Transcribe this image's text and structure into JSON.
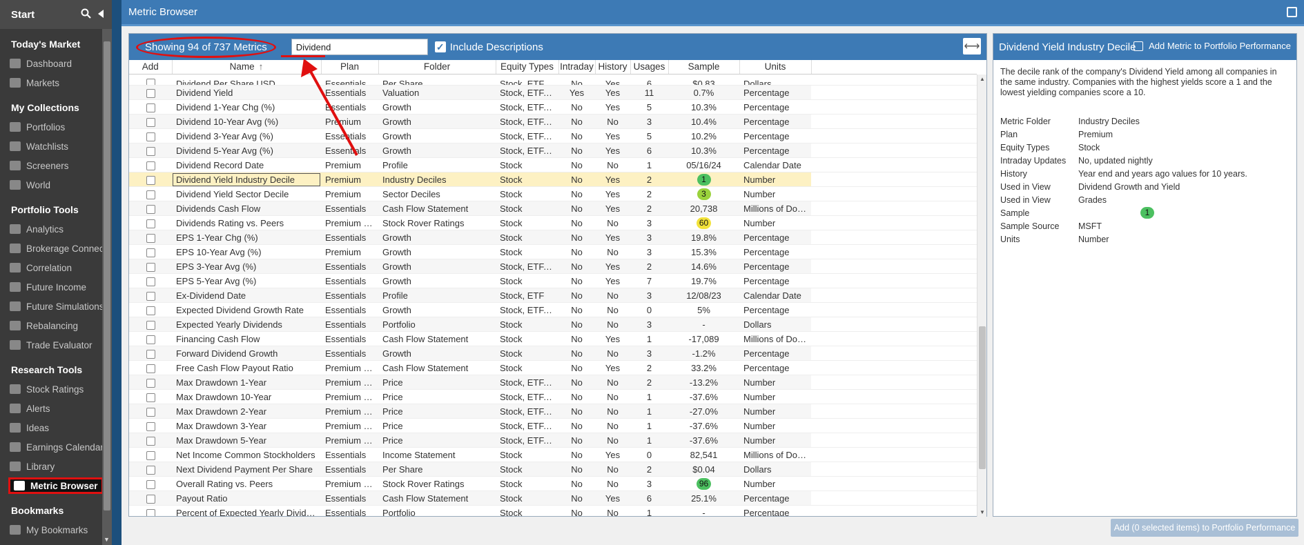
{
  "sidebar": {
    "start_label": "Start",
    "sections": [
      {
        "title": "Today's Market",
        "items": [
          {
            "label": "Dashboard",
            "icon": "dashboard-icon"
          },
          {
            "label": "Markets",
            "icon": "markets-icon"
          }
        ]
      },
      {
        "title": "My Collections",
        "items": [
          {
            "label": "Portfolios",
            "icon": "portfolios-icon"
          },
          {
            "label": "Watchlists",
            "icon": "watchlists-icon"
          },
          {
            "label": "Screeners",
            "icon": "screeners-icon"
          },
          {
            "label": "World",
            "icon": "world-icon"
          }
        ]
      },
      {
        "title": "Portfolio Tools",
        "items": [
          {
            "label": "Analytics",
            "icon": "analytics-icon"
          },
          {
            "label": "Brokerage Connect",
            "icon": "bank-icon"
          },
          {
            "label": "Correlation",
            "icon": "grid-icon"
          },
          {
            "label": "Future Income",
            "icon": "dollar-icon"
          },
          {
            "label": "Future Simulations",
            "icon": "chart-icon"
          },
          {
            "label": "Rebalancing",
            "icon": "scale-icon"
          },
          {
            "label": "Trade Evaluator",
            "icon": "briefcase-icon"
          }
        ]
      },
      {
        "title": "Research Tools",
        "items": [
          {
            "label": "Stock Ratings",
            "icon": "star-icon"
          },
          {
            "label": "Alerts",
            "icon": "bell-icon"
          },
          {
            "label": "Ideas",
            "icon": "lightbulb-icon"
          },
          {
            "label": "Earnings Calendar",
            "icon": "calendar-icon"
          },
          {
            "label": "Library",
            "icon": "library-icon"
          },
          {
            "label": "Metric Browser",
            "icon": "table-icon",
            "active": true
          }
        ]
      },
      {
        "title": "Bookmarks",
        "items": [
          {
            "label": "My Bookmarks",
            "icon": "bookmark-icon"
          }
        ]
      }
    ]
  },
  "titlebar": {
    "title": "Metric Browser"
  },
  "toolbar": {
    "count_text": "Showing 94 of 737 Metrics",
    "search_value": "Dividend",
    "include_descriptions_label": "Include Descriptions"
  },
  "columns": [
    "Add",
    "Name",
    "Plan",
    "Folder",
    "Equity Types",
    "Intraday",
    "History",
    "Usages",
    "Sample",
    "Units"
  ],
  "sort_indicator": "↑",
  "rows": [
    {
      "name": "Dividend Per Share USD",
      "plan": "Essentials",
      "folder": "Per Share",
      "equity": "Stock, ETF, Fund",
      "intraday": "No",
      "history": "Yes",
      "usages": "6",
      "sample": "$0.83",
      "units": "Dollars",
      "partial": true
    },
    {
      "name": "Dividend Yield",
      "plan": "Essentials",
      "folder": "Valuation",
      "equity": "Stock, ETF, Fund",
      "intraday": "Yes",
      "history": "Yes",
      "usages": "11",
      "sample": "0.7%",
      "units": "Percentage"
    },
    {
      "name": "Dividend 1-Year Chg (%)",
      "plan": "Essentials",
      "folder": "Growth",
      "equity": "Stock, ETF, Fund",
      "intraday": "No",
      "history": "Yes",
      "usages": "5",
      "sample": "10.3%",
      "units": "Percentage"
    },
    {
      "name": "Dividend 10-Year Avg (%)",
      "plan": "Premium",
      "folder": "Growth",
      "equity": "Stock, ETF, Fund",
      "intraday": "No",
      "history": "No",
      "usages": "3",
      "sample": "10.4%",
      "units": "Percentage"
    },
    {
      "name": "Dividend 3-Year Avg (%)",
      "plan": "Essentials",
      "folder": "Growth",
      "equity": "Stock, ETF, Fund",
      "intraday": "No",
      "history": "Yes",
      "usages": "5",
      "sample": "10.2%",
      "units": "Percentage"
    },
    {
      "name": "Dividend 5-Year Avg (%)",
      "plan": "Essentials",
      "folder": "Growth",
      "equity": "Stock, ETF, Fund",
      "intraday": "No",
      "history": "Yes",
      "usages": "6",
      "sample": "10.3%",
      "units": "Percentage"
    },
    {
      "name": "Dividend Record Date",
      "plan": "Premium",
      "folder": "Profile",
      "equity": "Stock",
      "intraday": "No",
      "history": "No",
      "usages": "1",
      "sample": "05/16/24",
      "units": "Calendar Date"
    },
    {
      "name": "Dividend Yield Industry Decile",
      "plan": "Premium",
      "folder": "Industry Deciles",
      "equity": "Stock",
      "intraday": "No",
      "history": "Yes",
      "usages": "2",
      "sample": "1",
      "units": "Number",
      "badge": "#4cc060",
      "selected": true
    },
    {
      "name": "Dividend Yield Sector Decile",
      "plan": "Premium",
      "folder": "Sector Deciles",
      "equity": "Stock",
      "intraday": "No",
      "history": "Yes",
      "usages": "2",
      "sample": "3",
      "units": "Number",
      "badge": "#9ad23c"
    },
    {
      "name": "Dividends Cash Flow",
      "plan": "Essentials",
      "folder": "Cash Flow Statement",
      "equity": "Stock",
      "intraday": "No",
      "history": "Yes",
      "usages": "2",
      "sample": "20,738",
      "units": "Millions of Dollars"
    },
    {
      "name": "Dividends Rating vs. Peers",
      "plan": "Premium Plus",
      "folder": "Stock Rover Ratings",
      "equity": "Stock",
      "intraday": "No",
      "history": "No",
      "usages": "3",
      "sample": "60",
      "units": "Number",
      "badge": "#f2e23a"
    },
    {
      "name": "EPS 1-Year Chg (%)",
      "plan": "Essentials",
      "folder": "Growth",
      "equity": "Stock",
      "intraday": "No",
      "history": "Yes",
      "usages": "3",
      "sample": "19.8%",
      "units": "Percentage"
    },
    {
      "name": "EPS 10-Year Avg (%)",
      "plan": "Premium",
      "folder": "Growth",
      "equity": "Stock",
      "intraday": "No",
      "history": "No",
      "usages": "3",
      "sample": "15.3%",
      "units": "Percentage"
    },
    {
      "name": "EPS 3-Year Avg (%)",
      "plan": "Essentials",
      "folder": "Growth",
      "equity": "Stock, ETF, Fund",
      "intraday": "No",
      "history": "Yes",
      "usages": "2",
      "sample": "14.6%",
      "units": "Percentage"
    },
    {
      "name": "EPS 5-Year Avg (%)",
      "plan": "Essentials",
      "folder": "Growth",
      "equity": "Stock",
      "intraday": "No",
      "history": "Yes",
      "usages": "7",
      "sample": "19.7%",
      "units": "Percentage"
    },
    {
      "name": "Ex-Dividend Date",
      "plan": "Essentials",
      "folder": "Profile",
      "equity": "Stock, ETF",
      "intraday": "No",
      "history": "No",
      "usages": "3",
      "sample": "12/08/23",
      "units": "Calendar Date"
    },
    {
      "name": "Expected Dividend Growth Rate",
      "plan": "Essentials",
      "folder": "Growth",
      "equity": "Stock, ETF, Fund",
      "intraday": "No",
      "history": "No",
      "usages": "0",
      "sample": "5%",
      "units": "Percentage"
    },
    {
      "name": "Expected Yearly Dividends",
      "plan": "Essentials",
      "folder": "Portfolio",
      "equity": "Stock",
      "intraday": "No",
      "history": "No",
      "usages": "3",
      "sample": "-",
      "units": "Dollars"
    },
    {
      "name": "Financing Cash Flow",
      "plan": "Essentials",
      "folder": "Cash Flow Statement",
      "equity": "Stock",
      "intraday": "No",
      "history": "Yes",
      "usages": "1",
      "sample": "-17,089",
      "units": "Millions of Dollars"
    },
    {
      "name": "Forward Dividend Growth",
      "plan": "Essentials",
      "folder": "Growth",
      "equity": "Stock",
      "intraday": "No",
      "history": "No",
      "usages": "3",
      "sample": "-1.2%",
      "units": "Percentage"
    },
    {
      "name": "Free Cash Flow Payout Ratio",
      "plan": "Premium Plus",
      "folder": "Cash Flow Statement",
      "equity": "Stock",
      "intraday": "No",
      "history": "Yes",
      "usages": "2",
      "sample": "33.2%",
      "units": "Percentage"
    },
    {
      "name": "Max Drawdown 1-Year",
      "plan": "Premium Plus",
      "folder": "Price",
      "equity": "Stock, ETF, Fund",
      "intraday": "No",
      "history": "No",
      "usages": "2",
      "sample": "-13.2%",
      "units": "Number"
    },
    {
      "name": "Max Drawdown 10-Year",
      "plan": "Premium Plus",
      "folder": "Price",
      "equity": "Stock, ETF, Fund",
      "intraday": "No",
      "history": "No",
      "usages": "1",
      "sample": "-37.6%",
      "units": "Number"
    },
    {
      "name": "Max Drawdown 2-Year",
      "plan": "Premium Plus",
      "folder": "Price",
      "equity": "Stock, ETF, Fund",
      "intraday": "No",
      "history": "No",
      "usages": "1",
      "sample": "-27.0%",
      "units": "Number"
    },
    {
      "name": "Max Drawdown 3-Year",
      "plan": "Premium Plus",
      "folder": "Price",
      "equity": "Stock, ETF, Fund",
      "intraday": "No",
      "history": "No",
      "usages": "1",
      "sample": "-37.6%",
      "units": "Number"
    },
    {
      "name": "Max Drawdown 5-Year",
      "plan": "Premium Plus",
      "folder": "Price",
      "equity": "Stock, ETF, Fund",
      "intraday": "No",
      "history": "No",
      "usages": "1",
      "sample": "-37.6%",
      "units": "Number"
    },
    {
      "name": "Net Income Common Stockholders",
      "plan": "Essentials",
      "folder": "Income Statement",
      "equity": "Stock",
      "intraday": "No",
      "history": "Yes",
      "usages": "0",
      "sample": "82,541",
      "units": "Millions of Dollars"
    },
    {
      "name": "Next Dividend Payment Per Share",
      "plan": "Essentials",
      "folder": "Per Share",
      "equity": "Stock",
      "intraday": "No",
      "history": "No",
      "usages": "2",
      "sample": "$0.04",
      "units": "Dollars"
    },
    {
      "name": "Overall Rating vs. Peers",
      "plan": "Premium Plus",
      "folder": "Stock Rover Ratings",
      "equity": "Stock",
      "intraday": "No",
      "history": "No",
      "usages": "3",
      "sample": "96",
      "units": "Number",
      "badge": "#4cc060"
    },
    {
      "name": "Payout Ratio",
      "plan": "Essentials",
      "folder": "Cash Flow Statement",
      "equity": "Stock",
      "intraday": "No",
      "history": "Yes",
      "usages": "6",
      "sample": "25.1%",
      "units": "Percentage"
    },
    {
      "name": "Percent of Expected Yearly Dividends",
      "plan": "Essentials",
      "folder": "Portfolio",
      "equity": "Stock",
      "intraday": "No",
      "history": "No",
      "usages": "1",
      "sample": "-",
      "units": "Percentage"
    }
  ],
  "detail": {
    "title": "Dividend Yield Industry Decile",
    "add_label": "Add Metric to Portfolio Performance",
    "description": "The decile rank of the company's Dividend Yield among all companies in the same industry. Companies with the highest yields score a 1 and the lowest yielding companies score a 10.",
    "props": [
      {
        "k": "Metric Folder",
        "v": "Industry Deciles"
      },
      {
        "k": "Plan",
        "v": "Premium"
      },
      {
        "k": "Equity Types",
        "v": "Stock"
      },
      {
        "k": "Intraday Updates",
        "v": "No, updated nightly"
      },
      {
        "k": "History",
        "v": "Year end and years ago values for 10 years."
      },
      {
        "k": "Used in View",
        "v": "Dividend Growth and Yield"
      },
      {
        "k": "Used in View",
        "v": "Grades"
      },
      {
        "k": "Sample",
        "v": "1",
        "badge": "#4cc060"
      },
      {
        "k": "Sample Source",
        "v": "MSFT"
      },
      {
        "k": "Units",
        "v": "Number"
      }
    ]
  },
  "bottom_button": "Add (0 selected items) to Portfolio Performance",
  "colors": {
    "header_blue": "#3d7ab5",
    "annotation_red": "#e01010",
    "selected_row": "#fdf1c3"
  }
}
